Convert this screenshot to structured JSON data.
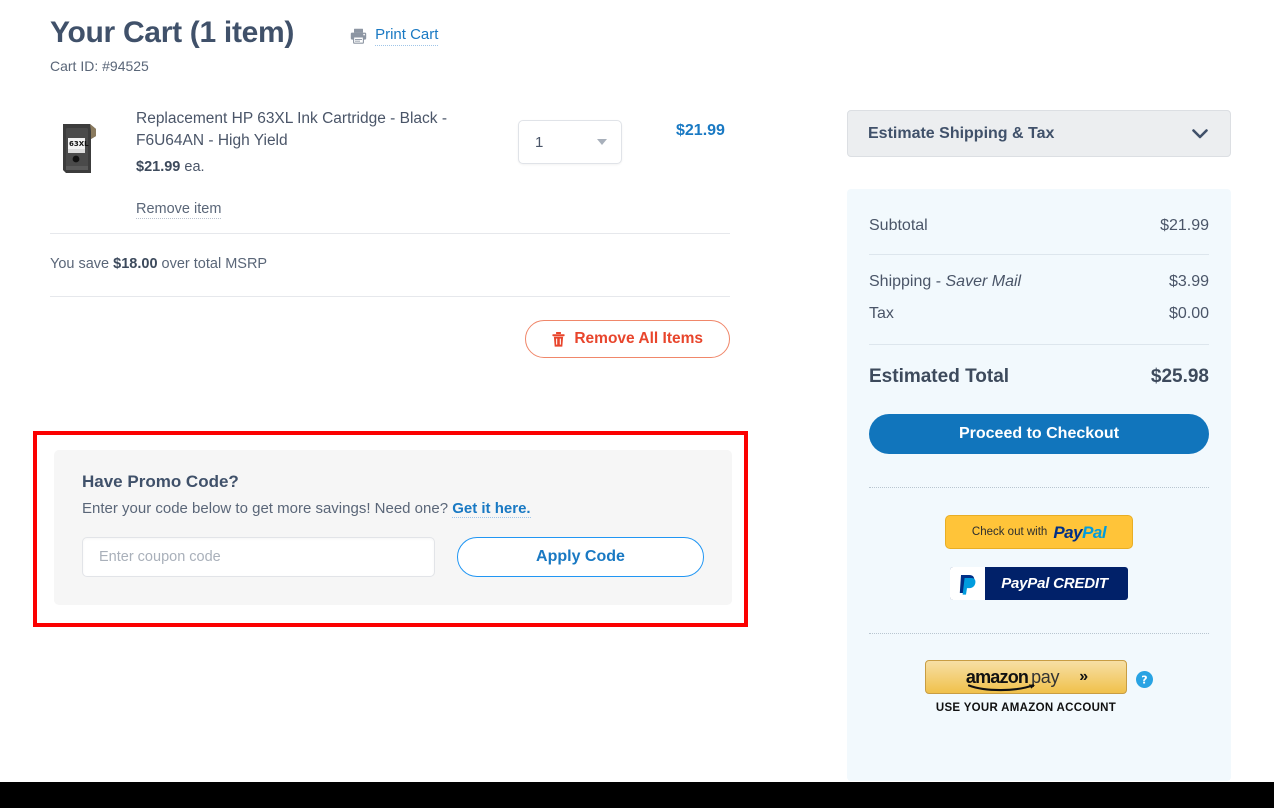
{
  "header": {
    "title": "Your Cart (1 item)",
    "print_cart_label": "Print Cart",
    "print_icon": "printer-icon",
    "cart_id": "Cart ID: #94525"
  },
  "cart": {
    "item": {
      "thumb_icon": "ink-cartridge-thumbnail",
      "name": "Replacement HP 63XL Ink Cartridge - Black - F6U64AN - High Yield",
      "unit_price": "$21.99",
      "unit_price_suffix": " ea.",
      "remove_label": "Remove item",
      "quantity": "1",
      "line_total": "$21.99"
    },
    "savings_prefix": "You save ",
    "savings_amount": "$18.00",
    "savings_suffix": " over total MSRP",
    "remove_all_label": "Remove All Items",
    "remove_all_icon": "trash-icon"
  },
  "promo": {
    "title": "Have Promo Code?",
    "subtitle_prefix": "Enter your code below to get more savings! Need one? ",
    "link_label": "Get it here.",
    "input_placeholder": "Enter coupon code",
    "input_value": "",
    "apply_label": "Apply Code",
    "highlight_color": "#fb0000"
  },
  "sidebar": {
    "estimate_label": "Estimate Shipping & Tax",
    "estimate_icon": "chevron-down-icon",
    "summary": {
      "subtotal_label": "Subtotal",
      "subtotal_value": "$21.99",
      "shipping_label": "Shipping",
      "shipping_dash": " - ",
      "shipping_method": "Saver Mail",
      "shipping_value": "$3.99",
      "tax_label": "Tax",
      "tax_value": "$0.00",
      "total_label": "Estimated Total",
      "total_value": "$25.98"
    },
    "checkout_label": "Proceed to Checkout",
    "paypal": {
      "checkout_text": "Check out with",
      "pay_word": "Pay",
      "pal_word": "Pal"
    },
    "paypal_credit": {
      "mark": "P",
      "brand": "PayPal ",
      "product": "CREDIT"
    },
    "amazon_pay": {
      "amazon_word": "amazon",
      "pay_word": "pay",
      "chevrons": "»",
      "caption": "USE YOUR AMAZON ACCOUNT",
      "help_icon": "help-question-icon"
    }
  },
  "colors": {
    "accent_blue": "#1979c3",
    "checkout_blue": "#1175bc",
    "danger_red": "#e8452c",
    "panel_bg": "#f2f9fd",
    "highlight": "#fb0000"
  }
}
